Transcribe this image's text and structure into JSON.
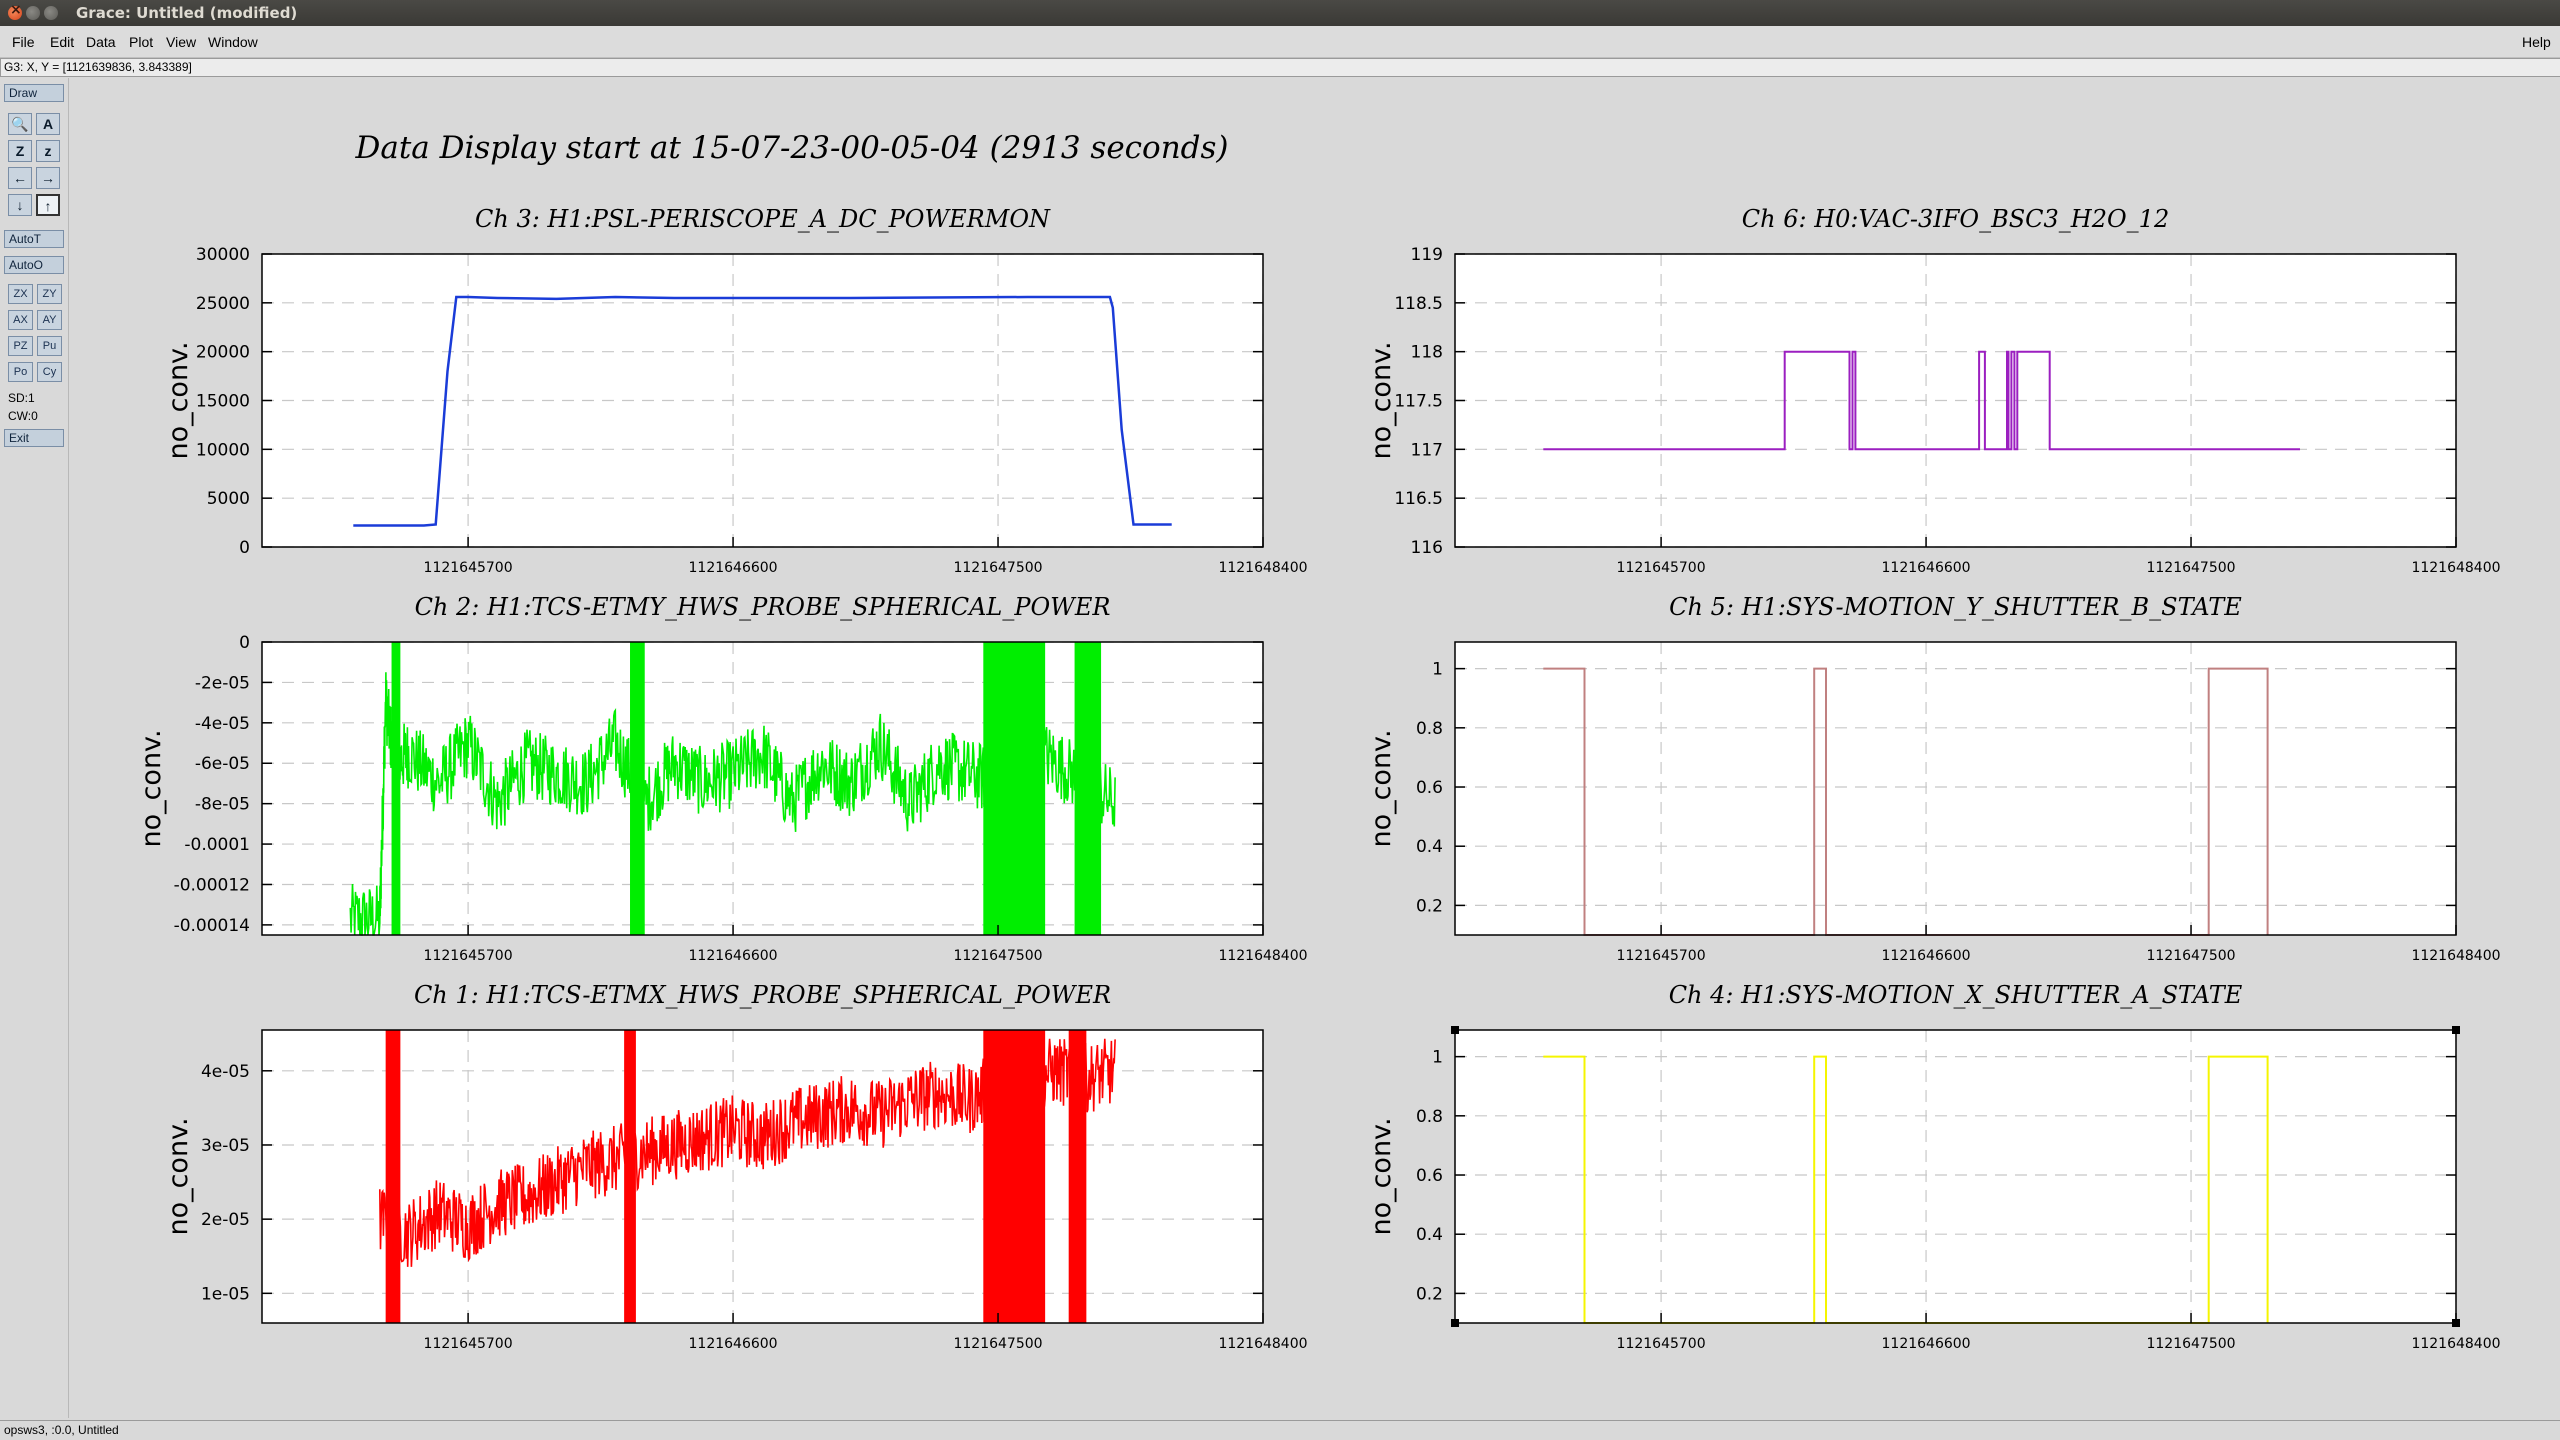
{
  "window": {
    "title": "Grace: Untitled (modified)"
  },
  "menu": {
    "items": [
      "File",
      "Edit",
      "Data",
      "Plot",
      "View",
      "Window"
    ],
    "help": "Help"
  },
  "coords_readout": "G3: X, Y = [1121639836, 3.843389]",
  "toolbox": {
    "draw": "Draw",
    "icons": [
      "zoom-icon",
      "autoscale-icon",
      "zoom-x-icon",
      "zoom-y-icon",
      "pan-left-icon",
      "pan-right-icon",
      "pan-down-icon",
      "pan-up-icon"
    ],
    "icon_glyphs": [
      "🔍",
      "A",
      "Z",
      "z",
      "←",
      "→",
      "↓",
      "↑"
    ],
    "autot": "AutoT",
    "autoo": "AutoO",
    "small_buttons": [
      "ZX",
      "ZY",
      "AX",
      "AY",
      "PZ",
      "Pu",
      "Po",
      "Cy"
    ],
    "sd": "SD:1",
    "cw": "CW:0",
    "exit": "Exit"
  },
  "status": "opsws3, :0.0, Untitled",
  "page_title": "Data Display start at 15-07-23-00-05-04 (2913 seconds)",
  "chart_data": [
    {
      "type": "line",
      "title": "Ch 3: H1:PSL-PERISCOPE_A_DC_POWERMON",
      "ylabel": "no_conv.",
      "color": "#1a3cd8",
      "xlim": [
        1121645000,
        1121648400
      ],
      "ylim": [
        0,
        30000
      ],
      "xticks": [
        1121645700,
        1121646600,
        1121647500,
        1121648400
      ],
      "xtick_labels": [
        "1121645700",
        "1121646600",
        "1121647500",
        "1121648400"
      ],
      "yticks": [
        0,
        5000,
        10000,
        15000,
        20000,
        25000,
        30000
      ],
      "ytick_labels": [
        "0",
        "5000",
        "10000",
        "15000",
        "20000",
        "25000",
        "30000"
      ],
      "x": [
        1121645310,
        1121645550,
        1121645590,
        1121645630,
        1121645660,
        1121645700,
        1121645800,
        1121646000,
        1121646200,
        1121646400,
        1121647000,
        1121647600,
        1121647880,
        1121647890,
        1121647920,
        1121647960,
        1121648090
      ],
      "y": [
        2200,
        2200,
        2300,
        18000,
        25600,
        25600,
        25500,
        25400,
        25600,
        25500,
        25500,
        25600,
        25600,
        24500,
        12000,
        2300,
        2300
      ]
    },
    {
      "type": "line",
      "title": "Ch 6: H0:VAC-3IFO_BSC3_H2O_12",
      "ylabel": "no_conv.",
      "color": "#9b1fc0",
      "xlim": [
        1121645000,
        1121648400
      ],
      "ylim": [
        116,
        119
      ],
      "xticks": [
        1121645700,
        1121646600,
        1121647500,
        1121648400
      ],
      "xtick_labels": [
        "1121645700",
        "1121646600",
        "1121647500",
        "1121648400"
      ],
      "yticks": [
        116,
        116.5,
        117,
        117.5,
        118,
        118.5,
        119
      ],
      "ytick_labels": [
        "116",
        "116.5",
        "117",
        "117.5",
        "118",
        "118.5",
        "119"
      ],
      "x": [
        1121645300,
        1121646120,
        1121646120,
        1121646340,
        1121646340,
        1121646350,
        1121646350,
        1121646360,
        1121646360,
        1121646780,
        1121646780,
        1121646800,
        1121646800,
        1121646875,
        1121646875,
        1121646880,
        1121646880,
        1121646890,
        1121646890,
        1121646900,
        1121646900,
        1121646910,
        1121646910,
        1121647020,
        1121647020,
        1121647870
      ],
      "y": [
        117,
        117,
        118,
        118,
        117,
        117,
        118,
        118,
        117,
        117,
        118,
        118,
        117,
        117,
        118,
        118,
        117,
        117,
        118,
        118,
        117,
        117,
        118,
        118,
        117,
        117
      ]
    },
    {
      "type": "line",
      "title": "Ch 2: H1:TCS-ETMY_HWS_PROBE_SPHERICAL_POWER",
      "ylabel": "no_conv.",
      "color": "#00ee00",
      "xlim": [
        1121645000,
        1121648400
      ],
      "ylim": [
        -0.000145,
        0
      ],
      "xticks": [
        1121645700,
        1121646600,
        1121647500,
        1121648400
      ],
      "xtick_labels": [
        "1121645700",
        "1121646600",
        "1121647500",
        "1121648400"
      ],
      "yticks": [
        0,
        -2e-05,
        -4e-05,
        -6e-05,
        -8e-05,
        -0.0001,
        -0.00012,
        -0.00014
      ],
      "ytick_labels": [
        "0",
        "-2e-05",
        "-4e-05",
        "-6e-05",
        "-8e-05",
        "-0.0001",
        "-0.00012",
        "-0.00014"
      ],
      "x": [
        1121645300,
        1121645400,
        1121645420,
        1121645450,
        1121645500,
        1121645600,
        1121645700,
        1121645800,
        1121645900,
        1121646000,
        1121646100,
        1121646200,
        1121646300,
        1121646400,
        1121646500,
        1121646600,
        1121646700,
        1121646800,
        1121646900,
        1121647000,
        1121647100,
        1121647200,
        1121647300,
        1121647400,
        1121647500,
        1121647600,
        1121647700,
        1121647800,
        1121647900
      ],
      "y": [
        -0.000137,
        -0.000137,
        -3e-05,
        -6e-05,
        -5.5e-05,
        -7e-05,
        -5e-05,
        -8e-05,
        -6e-05,
        -6.5e-05,
        -7e-05,
        -5e-05,
        -8e-05,
        -6e-05,
        -7e-05,
        -6.5e-05,
        -5.5e-05,
        -8e-05,
        -6e-05,
        -7e-05,
        -5e-05,
        -8e-05,
        -6e-05,
        -6.5e-05,
        -7e-05,
        -5e-05,
        -6e-05,
        -7e-05,
        -8e-05
      ]
    },
    {
      "type": "line",
      "title": "Ch 5: H1:SYS-MOTION_Y_SHUTTER_B_STATE",
      "ylabel": "no_conv.",
      "color": "#c08080",
      "xlim": [
        1121645000,
        1121648400
      ],
      "ylim": [
        0.1,
        1.09
      ],
      "xticks": [
        1121645700,
        1121646600,
        1121647500,
        1121648400
      ],
      "xtick_labels": [
        "1121645700",
        "1121646600",
        "1121647500",
        "1121648400"
      ],
      "yticks": [
        0.2,
        0.4,
        0.6,
        0.8,
        1
      ],
      "ytick_labels": [
        "0.2",
        "0.4",
        "0.6",
        "0.8",
        "1"
      ],
      "x": [
        1121645300,
        1121645440,
        1121645440,
        1121646220,
        1121646220,
        1121646260,
        1121646260,
        1121647560,
        1121647560,
        1121647760,
        1121647760
      ],
      "y": [
        1,
        1,
        0.1,
        0.1,
        1,
        1,
        0.1,
        0.1,
        1,
        1,
        0.1
      ]
    },
    {
      "type": "line",
      "title": "Ch 1: H1:TCS-ETMX_HWS_PROBE_SPHERICAL_POWER",
      "ylabel": "no_conv.",
      "color": "#ff0000",
      "xlim": [
        1121645000,
        1121648400
      ],
      "ylim": [
        6e-06,
        4.55e-05
      ],
      "xticks": [
        1121645700,
        1121646600,
        1121647500,
        1121648400
      ],
      "xtick_labels": [
        "1121645700",
        "1121646600",
        "1121647500",
        "1121648400"
      ],
      "yticks": [
        1e-05,
        2e-05,
        3e-05,
        4e-05
      ],
      "ytick_labels": [
        "1e-05",
        "2e-05",
        "3e-05",
        "4e-05"
      ],
      "x": [
        1121645400,
        1121645500,
        1121645600,
        1121645700,
        1121645800,
        1121645900,
        1121646000,
        1121646100,
        1121646200,
        1121646300,
        1121646400,
        1121646500,
        1121646600,
        1121646700,
        1121646800,
        1121646900,
        1121647000,
        1121647100,
        1121647200,
        1121647300,
        1121647400,
        1121647500,
        1121647600,
        1121647700,
        1121647800,
        1121647900
      ],
      "y": [
        2e-05,
        1.8e-05,
        2.1e-05,
        1.9e-05,
        2.2e-05,
        2.3e-05,
        2.5e-05,
        2.7e-05,
        2.8e-05,
        2.9e-05,
        3e-05,
        3.1e-05,
        3.2e-05,
        3.1e-05,
        3.3e-05,
        3.4e-05,
        3.5e-05,
        3.4e-05,
        3.6e-05,
        3.7e-05,
        3.6e-05,
        3.8e-05,
        3.9e-05,
        4e-05,
        3.9e-05,
        4e-05
      ]
    },
    {
      "type": "line",
      "title": "Ch 4: H1:SYS-MOTION_X_SHUTTER_A_STATE",
      "ylabel": "no_conv.",
      "color": "#f5f500",
      "xlim": [
        1121645000,
        1121648400
      ],
      "ylim": [
        0.1,
        1.09
      ],
      "xticks": [
        1121645700,
        1121646600,
        1121647500,
        1121648400
      ],
      "xtick_labels": [
        "1121645700",
        "1121646600",
        "1121647500",
        "1121648400"
      ],
      "yticks": [
        0.2,
        0.4,
        0.6,
        0.8,
        1
      ],
      "ytick_labels": [
        "0.2",
        "0.4",
        "0.6",
        "0.8",
        "1"
      ],
      "x": [
        1121645300,
        1121645440,
        1121645440,
        1121646220,
        1121646220,
        1121646260,
        1121646260,
        1121647560,
        1121647560,
        1121647760,
        1121647760
      ],
      "y": [
        1,
        1,
        0.1,
        0.1,
        1,
        1,
        0.1,
        0.1,
        1,
        1,
        0.1
      ]
    }
  ]
}
